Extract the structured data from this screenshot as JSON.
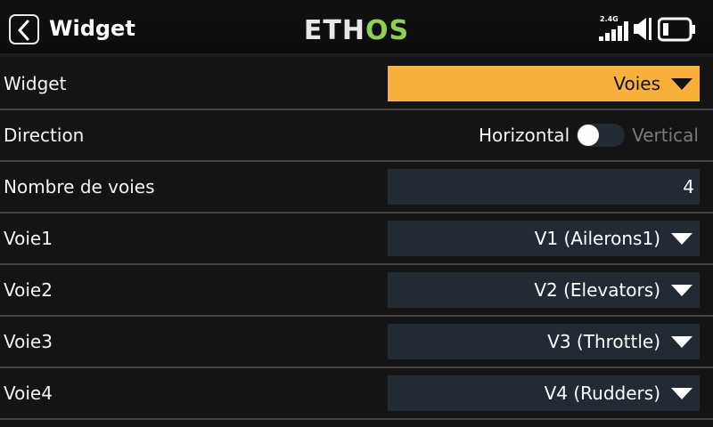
{
  "header": {
    "title": "Widget",
    "logo_text": "ETHOS",
    "radio_band": "2.4G"
  },
  "rows": {
    "widget": {
      "label": "Widget",
      "value": "Voies"
    },
    "direction": {
      "label": "Direction",
      "option_on": "Horizontal",
      "option_off": "Vertical"
    },
    "channel_count": {
      "label": "Nombre de voies",
      "value": "4"
    },
    "channel1": {
      "label": "Voie1",
      "value": "V1 (Ailerons1)"
    },
    "channel2": {
      "label": "Voie2",
      "value": "V2 (Elevators)"
    },
    "channel3": {
      "label": "Voie3",
      "value": "V3 (Throttle)"
    },
    "channel4": {
      "label": "Voie4",
      "value": "V4 (Rudders)"
    }
  },
  "colors": {
    "highlight": "#f7b13b",
    "field_bg": "#222a33",
    "logo_accent": "#8fd14f"
  },
  "icons": [
    "back-chevron-icon",
    "signal-bars-icon",
    "speaker-icon",
    "battery-icon"
  ]
}
